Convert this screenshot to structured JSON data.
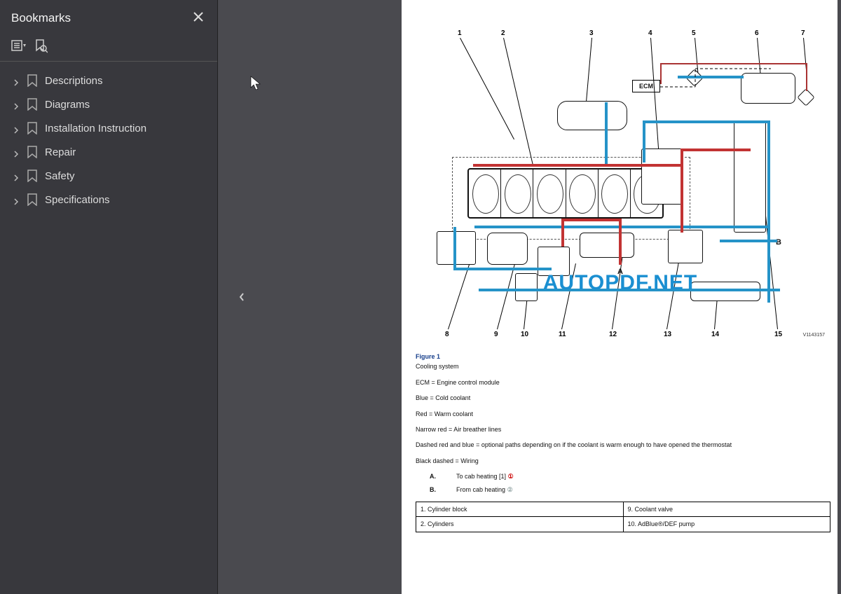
{
  "sidebar": {
    "title": "Bookmarks",
    "items": [
      {
        "label": "Descriptions"
      },
      {
        "label": "Diagrams"
      },
      {
        "label": "Installation Instruction"
      },
      {
        "label": "Repair"
      },
      {
        "label": "Safety"
      },
      {
        "label": "Specifications"
      }
    ]
  },
  "watermark": "AUTOPDF.NET",
  "diagram": {
    "ecm_label": "ECM",
    "top_callouts": [
      "1",
      "2",
      "3",
      "4",
      "5",
      "6",
      "7"
    ],
    "bottom_callouts": [
      "8",
      "9",
      "10",
      "11",
      "12",
      "13",
      "14",
      "15"
    ],
    "A_label": "A",
    "B_label": "B",
    "part_number": "V1143157"
  },
  "figure": {
    "label": "Figure 1",
    "caption": "Cooling system",
    "lines": [
      "ECM = Engine control module",
      "Blue = Cold coolant",
      "Red = Warm coolant",
      "Narrow red = Air breather lines",
      "Dashed red and blue = optional paths depending on if the coolant is warm enough to have opened the thermostat",
      "Black dashed = Wiring"
    ],
    "kv": {
      "A": {
        "key": "A.",
        "value": "To cab heating [1]",
        "mark": "①"
      },
      "B": {
        "key": "B.",
        "value": "From cab heating",
        "mark": "②"
      }
    },
    "table": [
      {
        "left": "1. Cylinder block",
        "right": "9. Coolant valve"
      },
      {
        "left": "2. Cylinders",
        "right": "10. AdBlue®/DEF pump"
      }
    ]
  }
}
